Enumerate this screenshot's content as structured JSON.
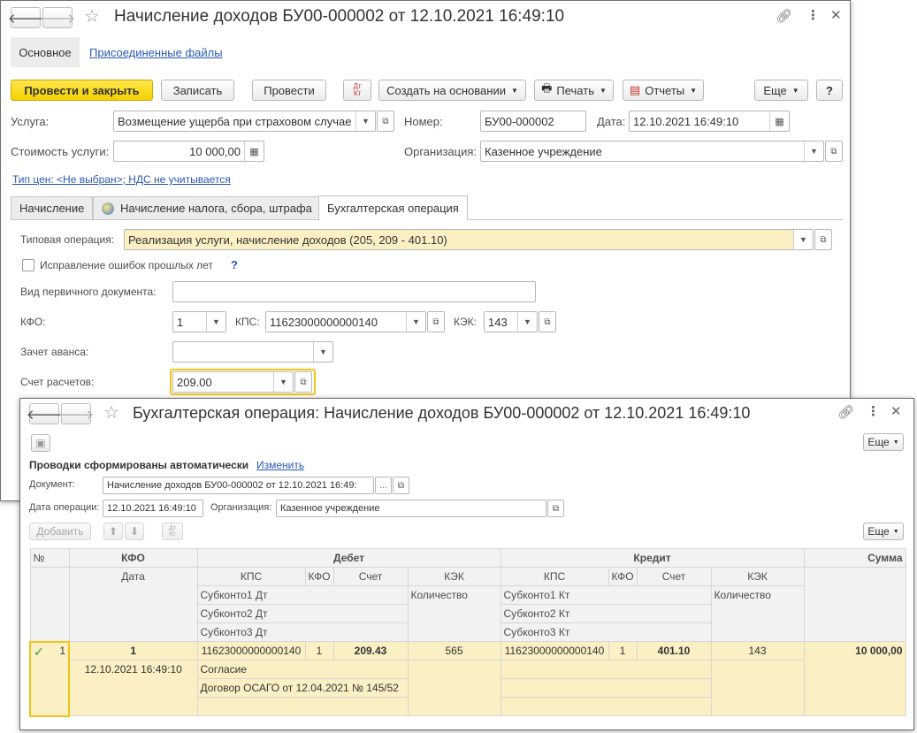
{
  "doc_window": {
    "title": "Начисление доходов БУ00-000002 от 12.10.2021 16:49:10",
    "section_tabs": [
      "Основное",
      "Присоединенные файлы"
    ],
    "toolbar": {
      "post_close": "Провести и закрыть",
      "save": "Записать",
      "post": "Провести",
      "dtkt": "Дт\nКт",
      "create_based": "Создать на основании",
      "print": "Печать",
      "reports": "Отчеты",
      "more": "Еще",
      "help": "?"
    },
    "fields": {
      "service_label": "Услуга:",
      "service_value": "Возмещение ущерба при страховом случае",
      "number_label": "Номер:",
      "number_value": "БУ00-000002",
      "date_label": "Дата:",
      "date_value": "12.10.2021 16:49:10",
      "cost_label": "Стоимость услуги:",
      "cost_value": "10 000,00",
      "org_label": "Организация:",
      "org_value": "Казенное учреждение"
    },
    "price_link": "Тип цен: <Не выбран>; НДС не учитывается",
    "tabs": [
      "Начисление",
      "Начисление налога, сбора, штрафа",
      "Бухгалтерская операция"
    ],
    "operation": {
      "typical_label": "Типовая операция:",
      "typical_value": "Реализация услуги, начисление доходов (205, 209 - 401.10)",
      "correction_label": "Исправление ошибок прошлых лет",
      "help": "?",
      "primary_doc_label": "Вид первичного документа:",
      "primary_doc_value": "",
      "kfo_label": "КФО:",
      "kfo_value": "1",
      "kps_label": "КПС:",
      "kps_value": "11623000000000140",
      "kek_label": "КЭК:",
      "kek_value": "143",
      "advance_label": "Зачет аванса:",
      "advance_value": "",
      "account_label": "Счет расчетов:",
      "account_value": "209.00"
    }
  },
  "op_window": {
    "title": "Бухгалтерская операция: Начисление доходов БУ00-000002 от 12.10.2021 16:49:10",
    "more": "Еще",
    "auto_text": "Проводки сформированы автоматически",
    "change_link": "Изменить",
    "document_label": "Документ:",
    "document_value": "Начисление доходов БУ00-000002 от 12.10.2021 16:49:",
    "doc_dots": "...",
    "op_date_label": "Дата операции:",
    "op_date_value": "12.10.2021 16:49:10",
    "org_label": "Организация:",
    "org_value": "Казенное учреждение",
    "add_button": "Добавить",
    "dtkt": "Дт\nКт",
    "more2": "Еще",
    "table": {
      "h_num": "№",
      "h_kfo": "КФО",
      "h_debit": "Дебет",
      "h_credit": "Кредит",
      "h_sum": "Сумма",
      "h_date": "Дата",
      "h_kps": "КПС",
      "h_kfo2": "КФО",
      "h_acc": "Счет",
      "h_kek": "КЭК",
      "h_qty": "Количество",
      "h_sub1dt": "Субконто1 Дт",
      "h_sub2dt": "Субконто2 Дт",
      "h_sub3dt": "Субконто3 Дт",
      "h_sub1kt": "Субконто1 Кт",
      "h_sub2kt": "Субконто2 Кт",
      "h_sub3kt": "Субконто3 Кт",
      "row": {
        "check": "✓",
        "num": "1",
        "kfo": "1",
        "date": "12.10.2021 16:49:10",
        "dt_kps": "11623000000000140",
        "dt_kfo": "1",
        "dt_acc": "209.43",
        "dt_kek": "565",
        "dt_sub1": "Согласие",
        "dt_sub2": "Договор ОСАГО от 12.04.2021 № 145/52",
        "kt_kps": "11623000000000140",
        "kt_kfo": "1",
        "kt_acc": "401.10",
        "kt_kek": "143",
        "sum": "10 000,00"
      }
    }
  },
  "icons": [
    "back-arrow-icon",
    "forward-arrow-icon",
    "star-icon",
    "link-icon",
    "more-vertical-icon",
    "close-icon",
    "calendar-icon",
    "dropdown-icon",
    "open-icon",
    "printer-icon",
    "report-icon",
    "save-disk-icon",
    "move-up-icon",
    "move-down-icon",
    "info-globe-icon",
    "checkmark-icon"
  ]
}
